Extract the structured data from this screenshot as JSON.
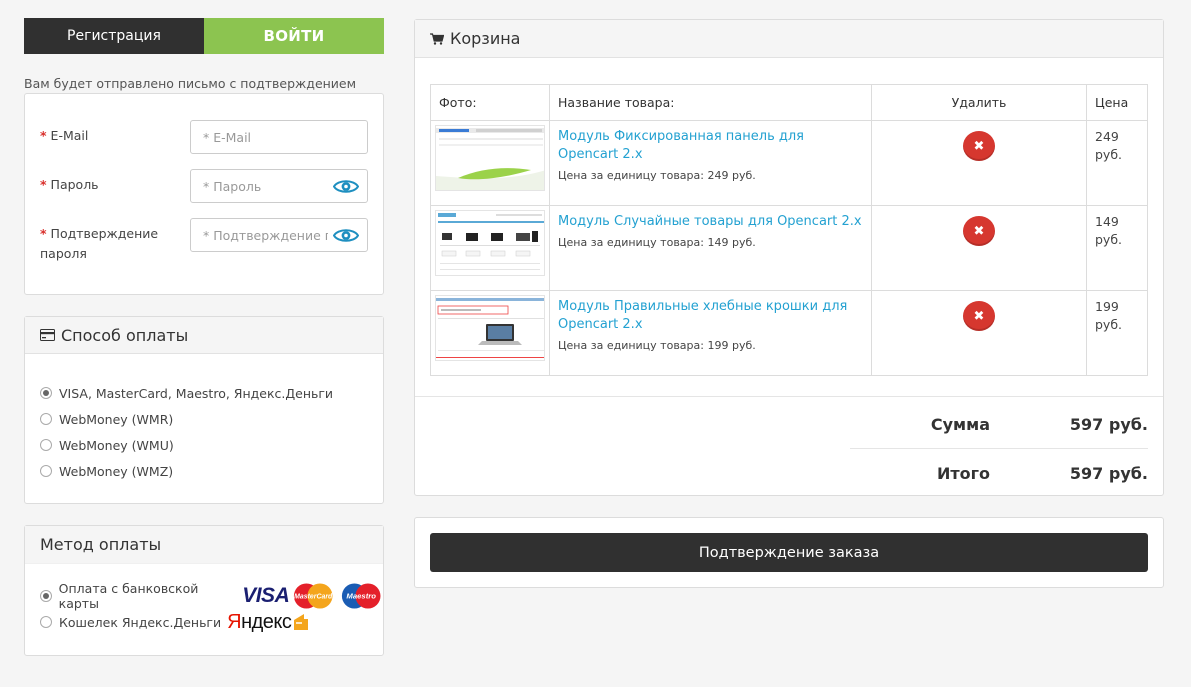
{
  "auth": {
    "tab_register": "Регистрация",
    "tab_login": "ВОЙТИ",
    "note": "Вам будет отправлено письмо с подтверждением",
    "fields": [
      {
        "label": "E-Mail",
        "placeholder": "* E-Mail"
      },
      {
        "label": "Пароль",
        "placeholder": "* Пароль"
      },
      {
        "label": "Подтверждение пароля",
        "placeholder": "* Подтверждение пароля"
      }
    ],
    "required_mark": "*"
  },
  "payment": {
    "title": "Способ оплаты",
    "options": [
      {
        "label": "VISA, MasterCard, Maestro, Яндекс.Деньги",
        "selected": true
      },
      {
        "label": "WebMoney (WMR)",
        "selected": false
      },
      {
        "label": "WebMoney (WMU)",
        "selected": false
      },
      {
        "label": "WebMoney (WMZ)",
        "selected": false
      }
    ]
  },
  "method": {
    "title": "Метод оплаты",
    "options": [
      {
        "label": "Оплата с банковской карты",
        "selected": true
      },
      {
        "label": "Кошелек Яндекс.Деньги",
        "selected": false
      }
    ],
    "logos": {
      "visa": "VISA",
      "mastercard": "MasterCard",
      "maestro": "Maestro",
      "yandex_first": "Я",
      "yandex_rest": "ндекс"
    }
  },
  "cart": {
    "title": "Корзина",
    "columns": {
      "photo": "Фото:",
      "name": "Название товара:",
      "delete": "Удалить",
      "price": "Цена"
    },
    "items": [
      {
        "name": "Модуль Фиксированная панель для Opencart 2.x",
        "unit_price": "Цена за единицу товара: 249 руб.",
        "price": "249 руб.",
        "thumb": "fixed-panel"
      },
      {
        "name": "Модуль Случайные товары для Opencart 2.x",
        "unit_price": "Цена за единицу товара: 149 руб.",
        "price": "149 руб.",
        "thumb": "random-products"
      },
      {
        "name": "Модуль Правильные хлебные крошки для Opencart 2.x",
        "unit_price": "Цена за единицу товара: 199 руб.",
        "price": "199 руб.",
        "thumb": "breadcrumbs"
      }
    ],
    "totals": [
      {
        "label": "Сумма",
        "value": "597 руб."
      },
      {
        "label": "Итого",
        "value": "597 руб."
      }
    ]
  },
  "confirm": {
    "label": "Подтверждение заказа"
  },
  "colors": {
    "login_green": "#8cc450",
    "dark": "#303030",
    "link": "#23a1d1",
    "delete_red": "#d6372f",
    "required": "#d9302c"
  }
}
